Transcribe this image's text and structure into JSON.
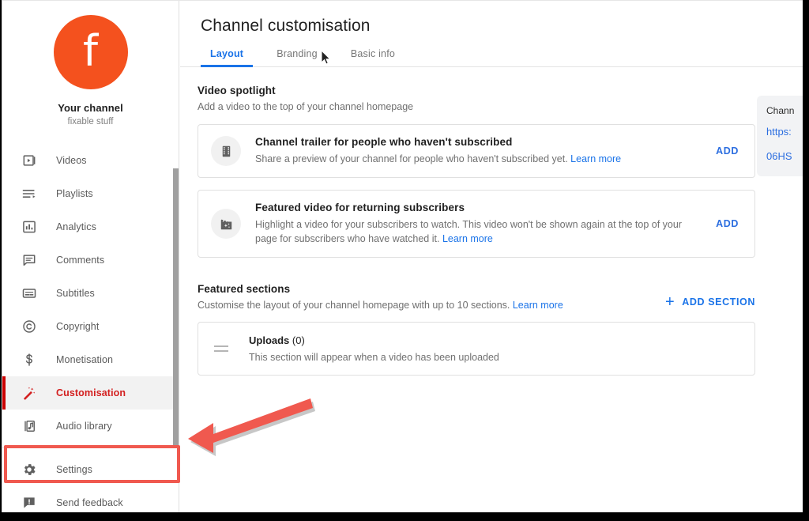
{
  "sidebar": {
    "channel": {
      "avatar_letter": "f",
      "avatar_color": "#f4511e",
      "name": "Your channel",
      "handle": "fixable stuff"
    },
    "items": [
      {
        "label": "Videos",
        "icon": "videos-icon",
        "active": false
      },
      {
        "label": "Playlists",
        "icon": "playlists-icon",
        "active": false
      },
      {
        "label": "Analytics",
        "icon": "analytics-icon",
        "active": false
      },
      {
        "label": "Comments",
        "icon": "comments-icon",
        "active": false
      },
      {
        "label": "Subtitles",
        "icon": "subtitles-icon",
        "active": false
      },
      {
        "label": "Copyright",
        "icon": "copyright-icon",
        "active": false
      },
      {
        "label": "Monetisation",
        "icon": "monetisation-icon",
        "active": false
      },
      {
        "label": "Customisation",
        "icon": "magic-wand-icon",
        "active": true
      },
      {
        "label": "Audio library",
        "icon": "audio-library-icon",
        "active": false
      }
    ],
    "footer_items": [
      {
        "label": "Settings",
        "icon": "gear-icon"
      },
      {
        "label": "Send feedback",
        "icon": "feedback-icon"
      }
    ],
    "active_color": "#d32020",
    "active_bar_color": "#cc0000"
  },
  "main": {
    "page_title": "Channel customisation",
    "tabs": [
      {
        "label": "Layout",
        "active": true
      },
      {
        "label": "Branding",
        "active": false
      },
      {
        "label": "Basic info",
        "active": false
      }
    ],
    "accent_color": "#1a73e8",
    "video_spotlight": {
      "title": "Video spotlight",
      "subtitle": "Add a video to the top of your channel homepage",
      "cards": [
        {
          "icon": "film-strip-icon",
          "title": "Channel trailer for people who haven't subscribed",
          "description": "Share a preview of your channel for people who haven't subscribed yet.",
          "learn_more": "Learn more",
          "action": "ADD"
        },
        {
          "icon": "clapperboard-sparkle-icon",
          "title": "Featured video for returning subscribers",
          "description": "Highlight a video for your subscribers to watch. This video won't be shown again at the top of your page for subscribers who have watched it.",
          "learn_more": "Learn more",
          "action": "ADD"
        }
      ]
    },
    "featured_sections": {
      "title": "Featured sections",
      "subtitle": "Customise the layout of your channel homepage with up to 10 sections.",
      "learn_more": "Learn more",
      "add_button": "ADD SECTION",
      "rows": [
        {
          "name": "Uploads",
          "count": "(0)",
          "description": "This section will appear when a video has been uploaded"
        }
      ]
    }
  },
  "right_panel": {
    "title": "Chann",
    "url_line1": "https:",
    "url_line2": "06HS"
  },
  "annotations": {
    "highlight_color": "#f0594f",
    "arrow_color": "#f0594f",
    "highlight_target": "Settings"
  }
}
